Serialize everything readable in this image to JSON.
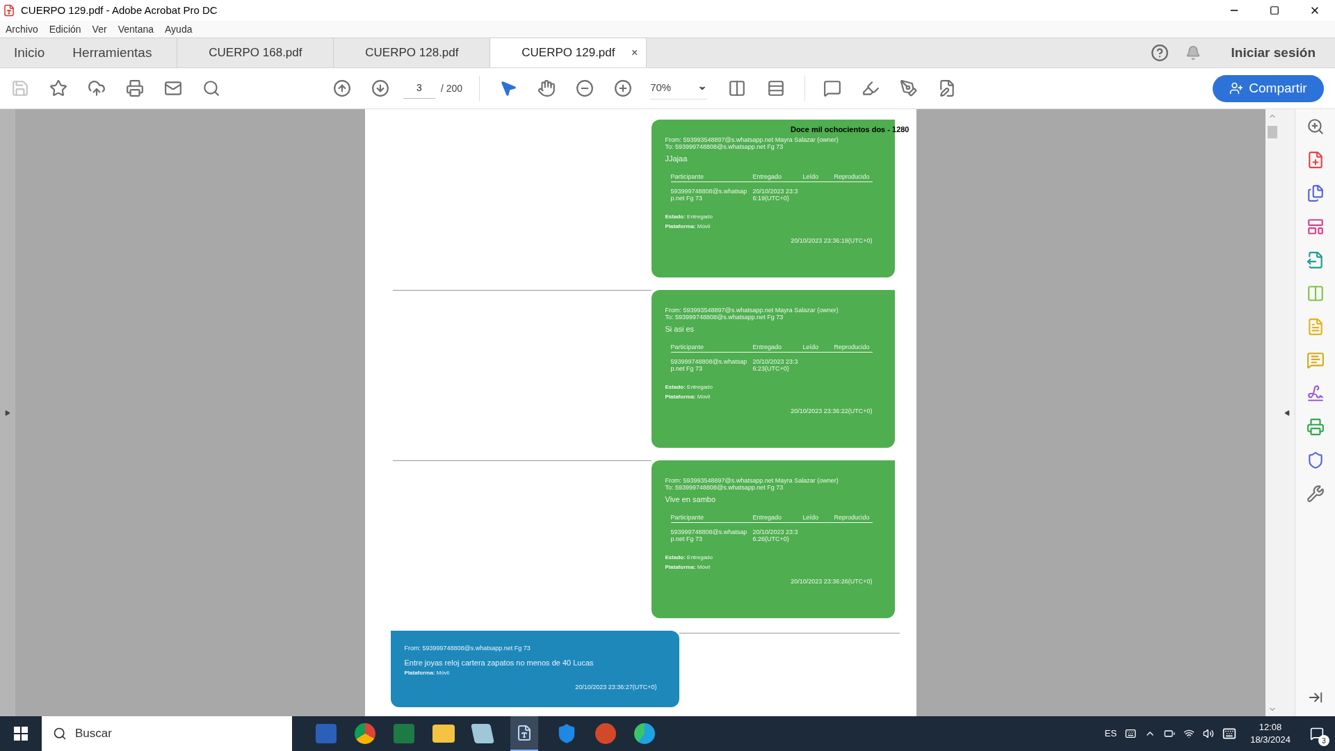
{
  "window": {
    "title": "CUERPO 129.pdf - Adobe Acrobat Pro DC"
  },
  "menu": [
    "Archivo",
    "Edición",
    "Ver",
    "Ventana",
    "Ayuda"
  ],
  "nav_tabs": [
    "Inicio",
    "Herramientas"
  ],
  "file_tabs": [
    {
      "label": "CUERPO 168.pdf",
      "selected": false
    },
    {
      "label": "CUERPO 128.pdf",
      "selected": false
    },
    {
      "label": "CUERPO 129.pdf",
      "selected": true
    }
  ],
  "tab_close": "×",
  "sign_in": "Iniciar sesión",
  "toolbar": {
    "page": "3",
    "page_total": "/ 200",
    "zoom": "70%",
    "share": "Compartir"
  },
  "document": {
    "header": "Doce mil ochocientos dos - 1280",
    "messages": [
      {
        "kind": "outgoing",
        "from": "From: 593993548897@s.whatsapp.net Mayra Salazar (owner)",
        "to": "To: 593999748808@s.whatsapp.net Fg 73",
        "body": "JJajaa",
        "columns": [
          "Participante",
          "Entregado",
          "Leído",
          "Reproducido"
        ],
        "row": [
          "593999748808@s.whatsapp.net Fg 73",
          "20/10/2023 23:36:19(UTC+0)"
        ],
        "status": "**Estado:** Entregado",
        "platform": "**Plataforma:** Móvil",
        "timestamp": "20/10/2023 23:36:19(UTC+0)"
      },
      {
        "kind": "outgoing",
        "from": "From: 593993548897@s.whatsapp.net Mayra Salazar (owner)",
        "to": "To: 593999748808@s.whatsapp.net Fg 73",
        "body": "Si asi es",
        "columns": [
          "Participante",
          "Entregado",
          "Leído",
          "Reproducido"
        ],
        "row": [
          "593999748808@s.whatsapp.net Fg 73",
          "20/10/2023 23:36:23(UTC+0)"
        ],
        "status": "**Estado:** Entregado",
        "platform": "**Plataforma:** Móvil",
        "timestamp": "20/10/2023 23:36:22(UTC+0)"
      },
      {
        "kind": "outgoing",
        "from": "From: 593993548897@s.whatsapp.net Mayra Salazar (owner)",
        "to": "To: 593999748808@s.whatsapp.net Fg 73",
        "body": "Vive en sambo",
        "columns": [
          "Participante",
          "Entregado",
          "Leído",
          "Reproducido"
        ],
        "row": [
          "593999748808@s.whatsapp.net Fg 73",
          "20/10/2023 23:36:26(UTC+0)"
        ],
        "status": "**Estado:** Entregado",
        "platform": "**Plataforma:** Móvil",
        "timestamp": "20/10/2023 23:36:26(UTC+0)"
      },
      {
        "kind": "incoming",
        "from": "From: 593999748808@s.whatsapp.net Fg 73",
        "body": "Entre joyas reloj cartera zapatos no menos de 40 Lucas",
        "platform": "**Plataforma:** Móvil",
        "timestamp": "20/10/2023 23:36:27(UTC+0)"
      }
    ]
  },
  "taskbar": {
    "search_placeholder": "Buscar",
    "language": "ES",
    "time": "12:08",
    "date": "18/3/2024",
    "notifications": "3"
  }
}
